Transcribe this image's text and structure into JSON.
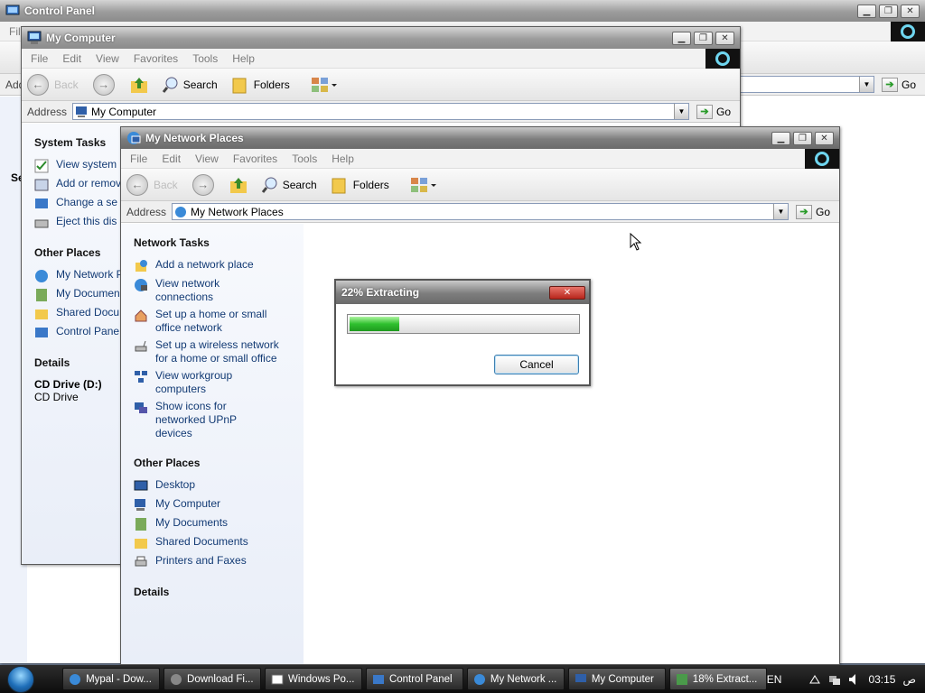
{
  "control_panel": {
    "title": "Control Panel",
    "address_prefix": "Addı",
    "menu_first": "Fil",
    "go": "Go",
    "left_labels": [
      "Se"
    ]
  },
  "my_computer": {
    "title": "My Computer",
    "menu": [
      "File",
      "Edit",
      "View",
      "Favorites",
      "Tools",
      "Help"
    ],
    "toolbar": {
      "back": "Back",
      "search": "Search",
      "folders": "Folders"
    },
    "address_label": "Address",
    "address_value": "My Computer",
    "go": "Go",
    "system_tasks": {
      "title": "System Tasks",
      "items": [
        "View system information",
        "Add or remove programs",
        "Change a se",
        "Eject this dis"
      ]
    },
    "other_places": {
      "title": "Other Places",
      "items": [
        "My Network P",
        "My Documen",
        "Shared Docu",
        "Control Pane"
      ]
    },
    "details": {
      "title": "Details",
      "name": "CD Drive (D:)",
      "type": "CD Drive"
    }
  },
  "network_places": {
    "title": "My Network Places",
    "menu": [
      "File",
      "Edit",
      "View",
      "Favorites",
      "Tools",
      "Help"
    ],
    "toolbar": {
      "back": "Back",
      "search": "Search",
      "folders": "Folders"
    },
    "address_label": "Address",
    "address_value": "My Network Places",
    "go": "Go",
    "network_tasks": {
      "title": "Network Tasks",
      "items": [
        "Add a network place",
        "View network connections",
        "Set up a home or small office network",
        "Set up a wireless network for a home or small office",
        "View workgroup computers",
        "Show icons for networked UPnP devices"
      ]
    },
    "other_places": {
      "title": "Other Places",
      "items": [
        "Desktop",
        "My Computer",
        "My Documents",
        "Shared Documents",
        "Printers and Faxes"
      ]
    },
    "details": {
      "title": "Details"
    }
  },
  "extract_dialog": {
    "title": "22% Extracting",
    "progress": 0.22,
    "cancel": "Cancel"
  },
  "taskbar": {
    "items": [
      "Mypal - Dow...",
      "Download Fi...",
      "Windows Po...",
      "Control Panel",
      "My Network ...",
      "My Computer",
      "18% Extract..."
    ],
    "language": "EN",
    "clock": "03:15",
    "am_pm": "ص"
  },
  "colors": {
    "link": "#123a74",
    "progress": "#2fc02f",
    "desktop": "#6f7f95"
  }
}
